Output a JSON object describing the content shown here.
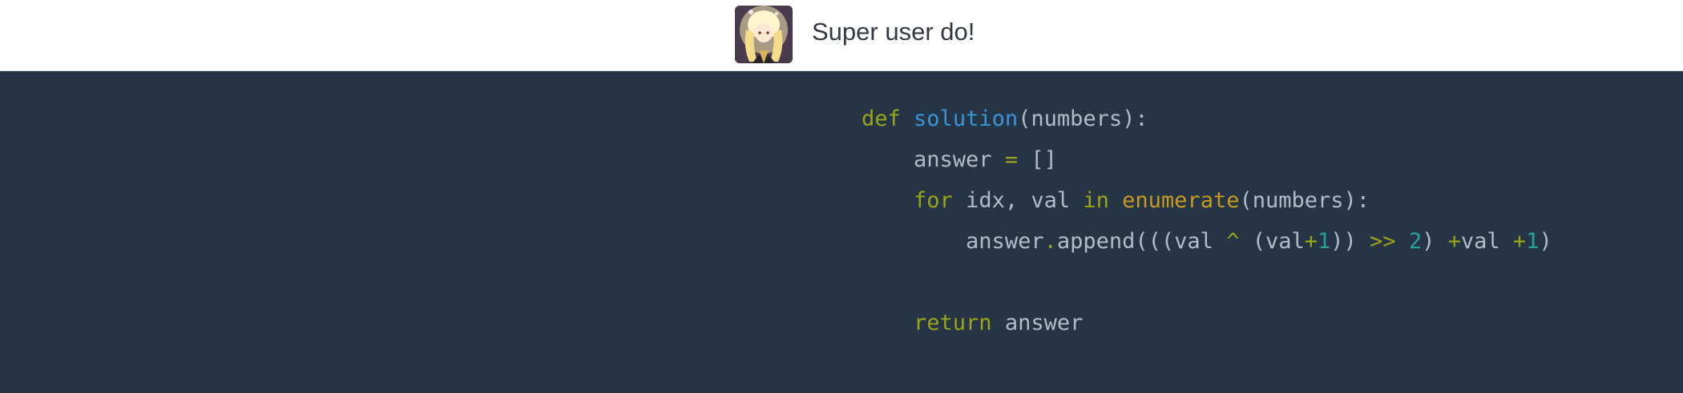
{
  "header": {
    "username": "Super user do!",
    "avatar_icon": "anime-avatar"
  },
  "code": {
    "language": "python",
    "colors": {
      "background": "#263545",
      "keyword": "#98a51a",
      "function": "#3b94d8",
      "builtin": "#c79a22",
      "number": "#2aa198",
      "text": "#b3bcc6"
    },
    "line1": {
      "kw_def": "def",
      "sp": " ",
      "fn": "solution",
      "rest": "(numbers):"
    },
    "line2": {
      "indent": "    ",
      "lhs": "answer ",
      "op": "=",
      "rhs": " []"
    },
    "line3": {
      "indent": "    ",
      "kw_for": "for",
      "mid": " idx, val ",
      "kw_in": "in",
      "sp": " ",
      "bi": "enumerate",
      "rest": "(numbers):"
    },
    "line4": {
      "indent": "        ",
      "a": "answer",
      "dot": ".",
      "b": "append(((val ",
      "xor": "^",
      "c": " (val",
      "plus1": "+",
      "one1": "1",
      "d": ")) ",
      "shift": ">>",
      "e": " ",
      "two": "2",
      "f": ") ",
      "plus2": "+",
      "g": "val ",
      "plus3": "+",
      "one2": "1",
      "h": ")"
    },
    "line5": "",
    "line6": {
      "indent": "    ",
      "kw_return": "return",
      "rest": " answer"
    }
  }
}
